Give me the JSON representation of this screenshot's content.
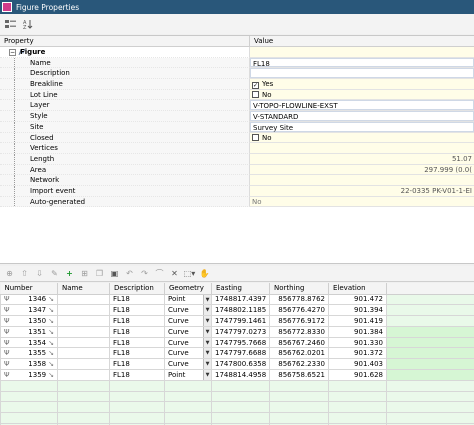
{
  "window": {
    "title": "Figure Properties"
  },
  "grid": {
    "headers": {
      "property": "Property",
      "value": "Value"
    },
    "root": {
      "label": "Figure"
    },
    "rows": [
      {
        "label": "Name",
        "value": "FL18",
        "type": "field"
      },
      {
        "label": "Description",
        "value": "",
        "type": "field"
      },
      {
        "label": "Breakline",
        "value": "Yes",
        "type": "check",
        "checked": true
      },
      {
        "label": "Lot Line",
        "value": "No",
        "type": "check",
        "checked": false
      },
      {
        "label": "Layer",
        "value": "V-TOPO-FLOWLINE-EXST",
        "type": "field"
      },
      {
        "label": "Style",
        "value": "V-STANDARD",
        "type": "field"
      },
      {
        "label": "Site",
        "value": "Survey Site",
        "type": "field"
      },
      {
        "label": "Closed",
        "value": "No",
        "type": "check",
        "checked": false
      },
      {
        "label": "Vertices",
        "value": "",
        "type": "ra"
      },
      {
        "label": "Length",
        "value": "51.07",
        "type": "ra"
      },
      {
        "label": "Area",
        "value": "297.999 (0.0(",
        "type": "ra"
      },
      {
        "label": "Network",
        "value": "",
        "type": "ra"
      },
      {
        "label": "Import event",
        "value": "22-0335 PK-V01-1-EI",
        "type": "ra"
      },
      {
        "label": "Auto-generated",
        "value": "No",
        "type": "muted"
      }
    ]
  },
  "vertices": {
    "columns": [
      "Number",
      "Name",
      "Description",
      "Geometry",
      "Easting",
      "Northing",
      "Elevation"
    ],
    "rows": [
      {
        "number": "1346",
        "name": "",
        "description": "FL18",
        "geometry": "Point",
        "easting": "1748817.4397",
        "northing": "856778.8762",
        "elevation": "901.472"
      },
      {
        "number": "1347",
        "name": "",
        "description": "FL18",
        "geometry": "Curve",
        "easting": "1748802.1185",
        "northing": "856776.4270",
        "elevation": "901.394"
      },
      {
        "number": "1350",
        "name": "",
        "description": "FL18",
        "geometry": "Curve",
        "easting": "1747799.1461",
        "northing": "856776.9172",
        "elevation": "901.419"
      },
      {
        "number": "1351",
        "name": "",
        "description": "FL18",
        "geometry": "Curve",
        "easting": "1747797.0273",
        "northing": "856772.8330",
        "elevation": "901.384"
      },
      {
        "number": "1354",
        "name": "",
        "description": "FL18",
        "geometry": "Curve",
        "easting": "1747795.7668",
        "northing": "856767.2460",
        "elevation": "901.330"
      },
      {
        "number": "1355",
        "name": "",
        "description": "FL18",
        "geometry": "Curve",
        "easting": "1747797.6688",
        "northing": "856762.0201",
        "elevation": "901.372"
      },
      {
        "number": "1358",
        "name": "",
        "description": "FL18",
        "geometry": "Curve",
        "easting": "1747800.6358",
        "northing": "856762.2330",
        "elevation": "901.403"
      },
      {
        "number": "1359",
        "name": "",
        "description": "FL18",
        "geometry": "Point",
        "easting": "1748814.4958",
        "northing": "856758.6521",
        "elevation": "901.628"
      }
    ],
    "empty_rows": 5
  },
  "colors": {
    "titlebar": "#29577a",
    "value_panel": "#fffde8",
    "empty_row": "#eaf9ea",
    "add_green": "#1f9a2f"
  },
  "icons": {
    "toolbar": [
      "sort-category-icon",
      "sort-alpha-icon"
    ],
    "vertex_toolbar": [
      "zoom-icon",
      "move-up-icon",
      "move-down-icon",
      "edit-icon",
      "add-vertex-icon",
      "insert-icon",
      "copy-icon",
      "import-icon",
      "undo-icon",
      "redo-icon",
      "curve-icon",
      "delete-icon",
      "select-icon",
      "pan-icon"
    ]
  }
}
